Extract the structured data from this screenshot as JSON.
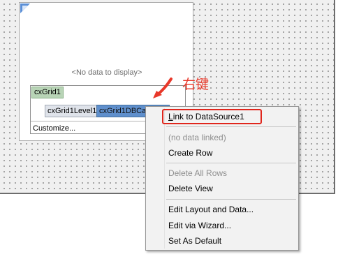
{
  "grid": {
    "no_data_text": "<No data to display>"
  },
  "structure": {
    "root_node": "cxGrid1",
    "level_node": "cxGrid1Level1",
    "view_node": "cxGrid1DBCardView1",
    "customize_label": "Customize..."
  },
  "annotation": {
    "text": "右键",
    "color": "#e8382a"
  },
  "context_menu": {
    "items": [
      {
        "label": "Link to DataSource1",
        "enabled": true,
        "highlighted": true
      },
      {
        "label": "(no data linked)",
        "enabled": false
      },
      {
        "label": "Create Row",
        "enabled": true
      },
      {
        "label": "Delete All Rows",
        "enabled": false
      },
      {
        "label": "Delete View",
        "enabled": true
      },
      {
        "label": "Edit Layout and Data...",
        "enabled": true
      },
      {
        "label": "Edit via Wizard...",
        "enabled": true
      },
      {
        "label": "Set As Default",
        "enabled": true
      }
    ]
  },
  "colors": {
    "selected_view": "#5f8fcc",
    "root_node": "#b8d4b6",
    "highlight_box": "#e0261c"
  }
}
